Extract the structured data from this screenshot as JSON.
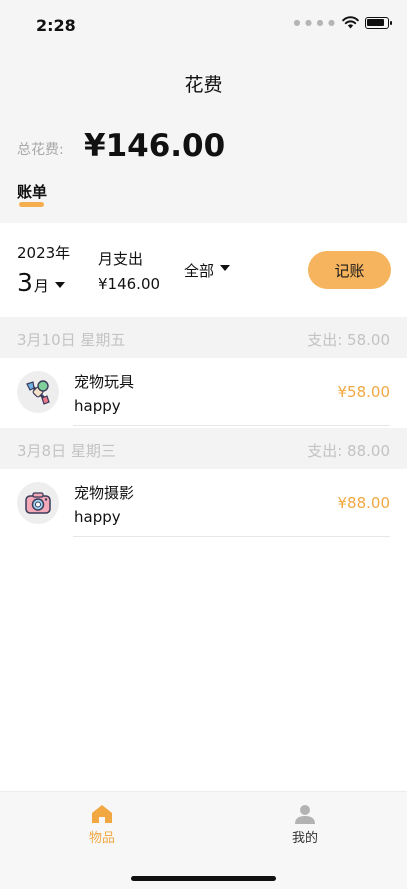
{
  "status_bar": {
    "time": "2:28"
  },
  "header": {
    "title": "花费",
    "total_label": "总花费:",
    "total_amount": "¥146.00",
    "tab_label": "账单"
  },
  "filter": {
    "year": "2023年",
    "month_num": "3",
    "month_unit": "月",
    "month_spend_label": "月支出",
    "month_spend_value": "¥146.00",
    "category": "全部",
    "record_button": "记账"
  },
  "days": [
    {
      "date": "3月10日 星期五",
      "total": "支出: 58.00",
      "items": [
        {
          "icon": "pet-toy-icon",
          "name": "宠物玩具",
          "note": "happy",
          "amount": "¥58.00"
        }
      ]
    },
    {
      "date": "3月8日 星期三",
      "total": "支出: 88.00",
      "items": [
        {
          "icon": "camera-icon",
          "name": "宠物摄影",
          "note": "happy",
          "amount": "¥88.00"
        }
      ]
    }
  ],
  "bottom_nav": {
    "items": [
      {
        "label": "物品",
        "icon": "home-icon",
        "active": true
      },
      {
        "label": "我的",
        "icon": "user-icon",
        "active": false
      }
    ]
  },
  "colors": {
    "accent": "#f6b45e",
    "amount": "#f2a842",
    "header_bg": "#f5f5f5"
  }
}
